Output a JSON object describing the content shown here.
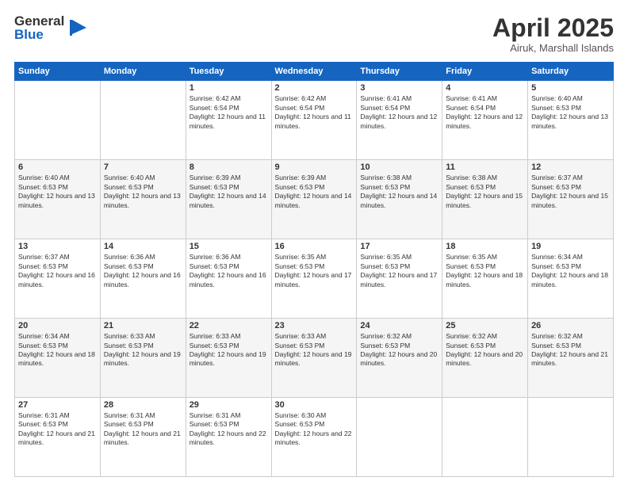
{
  "logo": {
    "general": "General",
    "blue": "Blue"
  },
  "calendar": {
    "title": "April 2025",
    "subtitle": "Airuk, Marshall Islands",
    "headers": [
      "Sunday",
      "Monday",
      "Tuesday",
      "Wednesday",
      "Thursday",
      "Friday",
      "Saturday"
    ],
    "weeks": [
      [
        {
          "day": "",
          "info": ""
        },
        {
          "day": "",
          "info": ""
        },
        {
          "day": "1",
          "info": "Sunrise: 6:42 AM\nSunset: 6:54 PM\nDaylight: 12 hours and 11 minutes."
        },
        {
          "day": "2",
          "info": "Sunrise: 6:42 AM\nSunset: 6:54 PM\nDaylight: 12 hours and 11 minutes."
        },
        {
          "day": "3",
          "info": "Sunrise: 6:41 AM\nSunset: 6:54 PM\nDaylight: 12 hours and 12 minutes."
        },
        {
          "day": "4",
          "info": "Sunrise: 6:41 AM\nSunset: 6:54 PM\nDaylight: 12 hours and 12 minutes."
        },
        {
          "day": "5",
          "info": "Sunrise: 6:40 AM\nSunset: 6:53 PM\nDaylight: 12 hours and 13 minutes."
        }
      ],
      [
        {
          "day": "6",
          "info": "Sunrise: 6:40 AM\nSunset: 6:53 PM\nDaylight: 12 hours and 13 minutes."
        },
        {
          "day": "7",
          "info": "Sunrise: 6:40 AM\nSunset: 6:53 PM\nDaylight: 12 hours and 13 minutes."
        },
        {
          "day": "8",
          "info": "Sunrise: 6:39 AM\nSunset: 6:53 PM\nDaylight: 12 hours and 14 minutes."
        },
        {
          "day": "9",
          "info": "Sunrise: 6:39 AM\nSunset: 6:53 PM\nDaylight: 12 hours and 14 minutes."
        },
        {
          "day": "10",
          "info": "Sunrise: 6:38 AM\nSunset: 6:53 PM\nDaylight: 12 hours and 14 minutes."
        },
        {
          "day": "11",
          "info": "Sunrise: 6:38 AM\nSunset: 6:53 PM\nDaylight: 12 hours and 15 minutes."
        },
        {
          "day": "12",
          "info": "Sunrise: 6:37 AM\nSunset: 6:53 PM\nDaylight: 12 hours and 15 minutes."
        }
      ],
      [
        {
          "day": "13",
          "info": "Sunrise: 6:37 AM\nSunset: 6:53 PM\nDaylight: 12 hours and 16 minutes."
        },
        {
          "day": "14",
          "info": "Sunrise: 6:36 AM\nSunset: 6:53 PM\nDaylight: 12 hours and 16 minutes."
        },
        {
          "day": "15",
          "info": "Sunrise: 6:36 AM\nSunset: 6:53 PM\nDaylight: 12 hours and 16 minutes."
        },
        {
          "day": "16",
          "info": "Sunrise: 6:35 AM\nSunset: 6:53 PM\nDaylight: 12 hours and 17 minutes."
        },
        {
          "day": "17",
          "info": "Sunrise: 6:35 AM\nSunset: 6:53 PM\nDaylight: 12 hours and 17 minutes."
        },
        {
          "day": "18",
          "info": "Sunrise: 6:35 AM\nSunset: 6:53 PM\nDaylight: 12 hours and 18 minutes."
        },
        {
          "day": "19",
          "info": "Sunrise: 6:34 AM\nSunset: 6:53 PM\nDaylight: 12 hours and 18 minutes."
        }
      ],
      [
        {
          "day": "20",
          "info": "Sunrise: 6:34 AM\nSunset: 6:53 PM\nDaylight: 12 hours and 18 minutes."
        },
        {
          "day": "21",
          "info": "Sunrise: 6:33 AM\nSunset: 6:53 PM\nDaylight: 12 hours and 19 minutes."
        },
        {
          "day": "22",
          "info": "Sunrise: 6:33 AM\nSunset: 6:53 PM\nDaylight: 12 hours and 19 minutes."
        },
        {
          "day": "23",
          "info": "Sunrise: 6:33 AM\nSunset: 6:53 PM\nDaylight: 12 hours and 19 minutes."
        },
        {
          "day": "24",
          "info": "Sunrise: 6:32 AM\nSunset: 6:53 PM\nDaylight: 12 hours and 20 minutes."
        },
        {
          "day": "25",
          "info": "Sunrise: 6:32 AM\nSunset: 6:53 PM\nDaylight: 12 hours and 20 minutes."
        },
        {
          "day": "26",
          "info": "Sunrise: 6:32 AM\nSunset: 6:53 PM\nDaylight: 12 hours and 21 minutes."
        }
      ],
      [
        {
          "day": "27",
          "info": "Sunrise: 6:31 AM\nSunset: 6:53 PM\nDaylight: 12 hours and 21 minutes."
        },
        {
          "day": "28",
          "info": "Sunrise: 6:31 AM\nSunset: 6:53 PM\nDaylight: 12 hours and 21 minutes."
        },
        {
          "day": "29",
          "info": "Sunrise: 6:31 AM\nSunset: 6:53 PM\nDaylight: 12 hours and 22 minutes."
        },
        {
          "day": "30",
          "info": "Sunrise: 6:30 AM\nSunset: 6:53 PM\nDaylight: 12 hours and 22 minutes."
        },
        {
          "day": "",
          "info": ""
        },
        {
          "day": "",
          "info": ""
        },
        {
          "day": "",
          "info": ""
        }
      ]
    ]
  }
}
